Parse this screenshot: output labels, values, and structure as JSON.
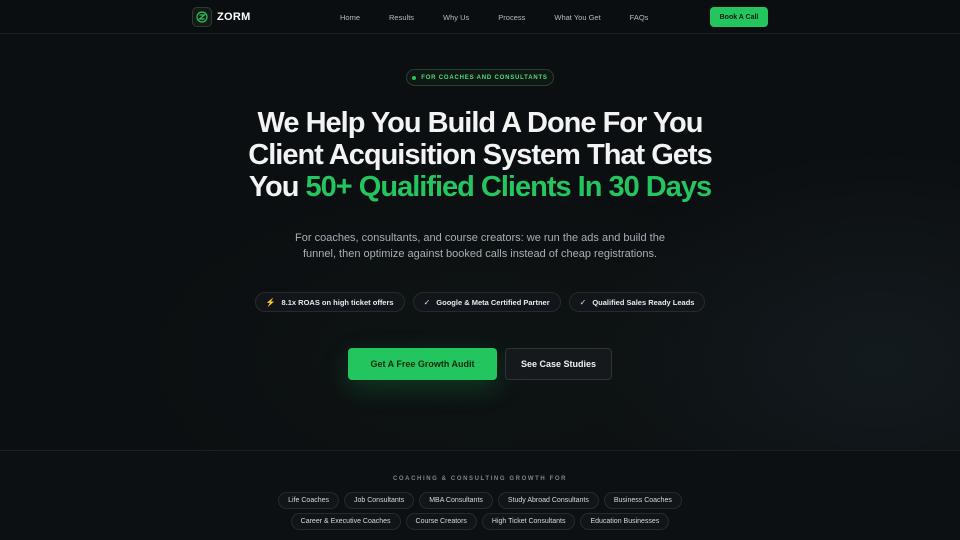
{
  "nav": {
    "logo_text": "ZORM",
    "links": [
      "Home",
      "Results",
      "Why Us",
      "Process",
      "What You Get",
      "FAQs"
    ],
    "cta_label": "Book A Call"
  },
  "hero": {
    "badge": "FOR COACHES AND CONSULTANTS",
    "headline_line1": "We Help You Build A Done For You",
    "headline_line2": "Client Acquisition System That Gets",
    "headline_line3_prefix": "You ",
    "headline_line3_accent": "50+ Qualified Clients In 30 Days",
    "subtitle": "For coaches, consultants, and course creators: we run the ads and build the funnel, then optimize against booked calls instead of cheap registrations.",
    "pills": [
      {
        "icon": "bolt-icon",
        "label": "8.1x ROAS on high ticket offers"
      },
      {
        "icon": "check-icon",
        "label": "Google & Meta Certified Partner"
      },
      {
        "icon": "check-icon",
        "label": "Qualified Sales Ready Leads"
      }
    ],
    "primary_cta": "Get A Free Growth Audit",
    "secondary_cta": "See Case Studies"
  },
  "growth": {
    "label": "COACHING & CONSULTING GROWTH FOR",
    "row1": [
      "Life Coaches",
      "Job Consultants",
      "MBA Consultants",
      "Study Abroad Consultants",
      "Business Coaches"
    ],
    "row2": [
      "Career & Executive Coaches",
      "Course Creators",
      "High Ticket Consultants",
      "Education Businesses"
    ]
  },
  "colors": {
    "accent": "#22c55e",
    "background": "#0c0f11"
  }
}
